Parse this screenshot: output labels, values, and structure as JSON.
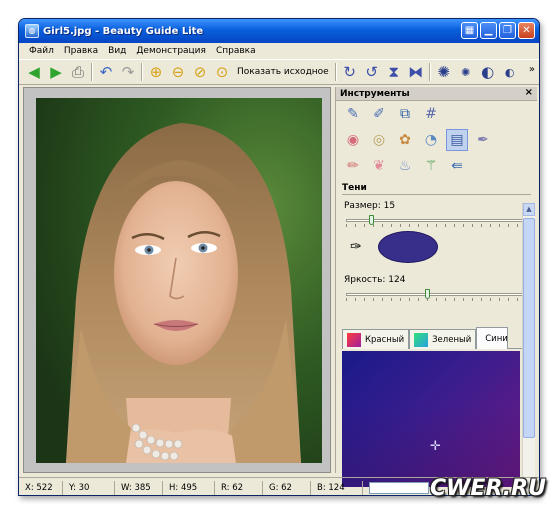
{
  "window": {
    "title": "Girl5.jpg - Beauty Guide Lite",
    "controls": [
      "▦",
      "▁",
      "❐",
      "✕"
    ]
  },
  "menu": [
    "Файл",
    "Правка",
    "Вид",
    "Демонстрация",
    "Справка"
  ],
  "toolbar": {
    "show_original": "Показать исходное",
    "icons": [
      "arrow-left-icon",
      "arrow-right-icon",
      "print-icon",
      "undo-icon",
      "redo-icon",
      "zoom-in-icon",
      "zoom-out-icon",
      "zoom-fit-icon",
      "zoom-actual-icon",
      "rotate-cw-icon",
      "rotate-ccw-icon",
      "flip-vertical-icon",
      "flip-horizontal-icon",
      "settings-icon",
      "small-settings-icon",
      "contrast-icon",
      "small-contrast-icon"
    ],
    "overflow": "»"
  },
  "panel": {
    "title": "Инструменты",
    "close": "×",
    "section": "Тени",
    "size_label": "Размер: 15",
    "size_value": 15,
    "brightness_label": "Яркость: 124",
    "brightness_value": 124,
    "shade_color": "#382f8a",
    "tabs": [
      {
        "label": "Красный",
        "color": "#e0245a"
      },
      {
        "label": "Зеленый",
        "color": "#2bd07a"
      },
      {
        "label": "Синий",
        "color": "#3b3bd8"
      }
    ]
  },
  "status": {
    "x": "X: 522",
    "y": "Y: 30",
    "w": "W: 385",
    "h": "H: 495",
    "r": "R: 62",
    "g": "G: 62",
    "b": "B: 124"
  },
  "watermark": "CWER.RU"
}
